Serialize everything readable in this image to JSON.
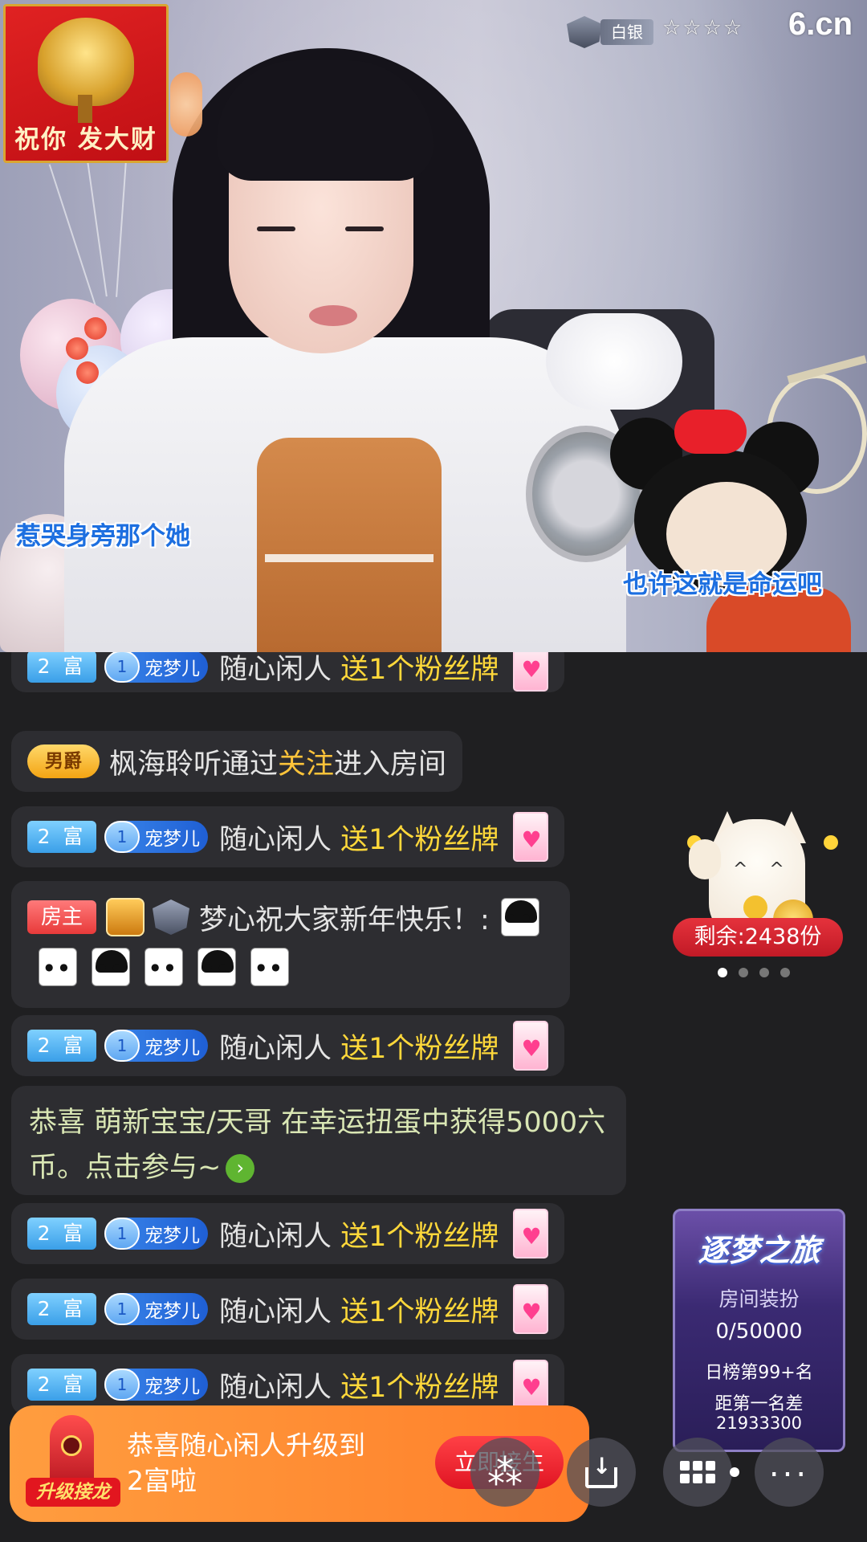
{
  "video": {
    "poster_text": "祝你 发大财",
    "lyric_left": "惹哭身旁那个她",
    "lyric_right": "也许这就是命运吧",
    "rank_label": "白银",
    "stars": "☆☆☆☆",
    "logo": "6.cn"
  },
  "chat": {
    "messages": [
      {
        "rich": "2 富",
        "fan_level": "1",
        "fan_name": "宠梦儿",
        "user": "随心闲人",
        "action": "送1个粉丝牌"
      },
      {
        "noble": "男爵",
        "text": "枫海聆听通过 ",
        "follow": "关注",
        "tail": " 进入房间"
      },
      {
        "rich": "2 富",
        "fan_level": "1",
        "fan_name": "宠梦儿",
        "user": "随心闲人",
        "action": "送1个粉丝牌"
      },
      {
        "host": "房主",
        "text": "梦心祝大家新年快乐！:"
      },
      {
        "rich": "2 富",
        "fan_level": "1",
        "fan_name": "宠梦儿",
        "user": "随心闲人",
        "action": "送1个粉丝牌"
      },
      {
        "lucky": "恭喜 萌新宝宝/天哥 在幸运扭蛋中获得5000六币。点击参与~"
      },
      {
        "rich": "2 富",
        "fan_level": "1",
        "fan_name": "宠梦儿",
        "user": "随心闲人",
        "action": "送1个粉丝牌"
      },
      {
        "rich": "2 富",
        "fan_level": "1",
        "fan_name": "宠梦儿",
        "user": "随心闲人",
        "action": "送1个粉丝牌"
      },
      {
        "rich": "2 富",
        "fan_level": "1",
        "fan_name": "宠梦儿",
        "user": "随心闲人",
        "action": "送1个粉丝牌"
      }
    ]
  },
  "lucky_cat": {
    "remain": "剩余:2438份",
    "dots": 4,
    "active_dot": 0
  },
  "journey": {
    "title": "逐梦之旅",
    "subtitle": "房间装扮",
    "progress": "0/50000",
    "rank": "日榜第99+名",
    "gap_label": "距第一名差",
    "gap_value": "21933300"
  },
  "upgrade": {
    "rocket_label": "升级接龙",
    "message": "恭喜随心闲人升级到\n2富啦",
    "button": "立即接生"
  },
  "controls": {
    "gift_icon": "gift-icon",
    "download_icon": "download-icon",
    "grid_icon": "grid-menu-icon",
    "more_icon": "more-icon"
  },
  "colors": {
    "rich_badge": "#3a9fe8",
    "gift_text": "#ffd83a",
    "follow_text": "#ffc43a",
    "host_badge": "#e83a3a",
    "remain_pill": "#c11a26",
    "upgrade_bg": "#ff8a30"
  }
}
